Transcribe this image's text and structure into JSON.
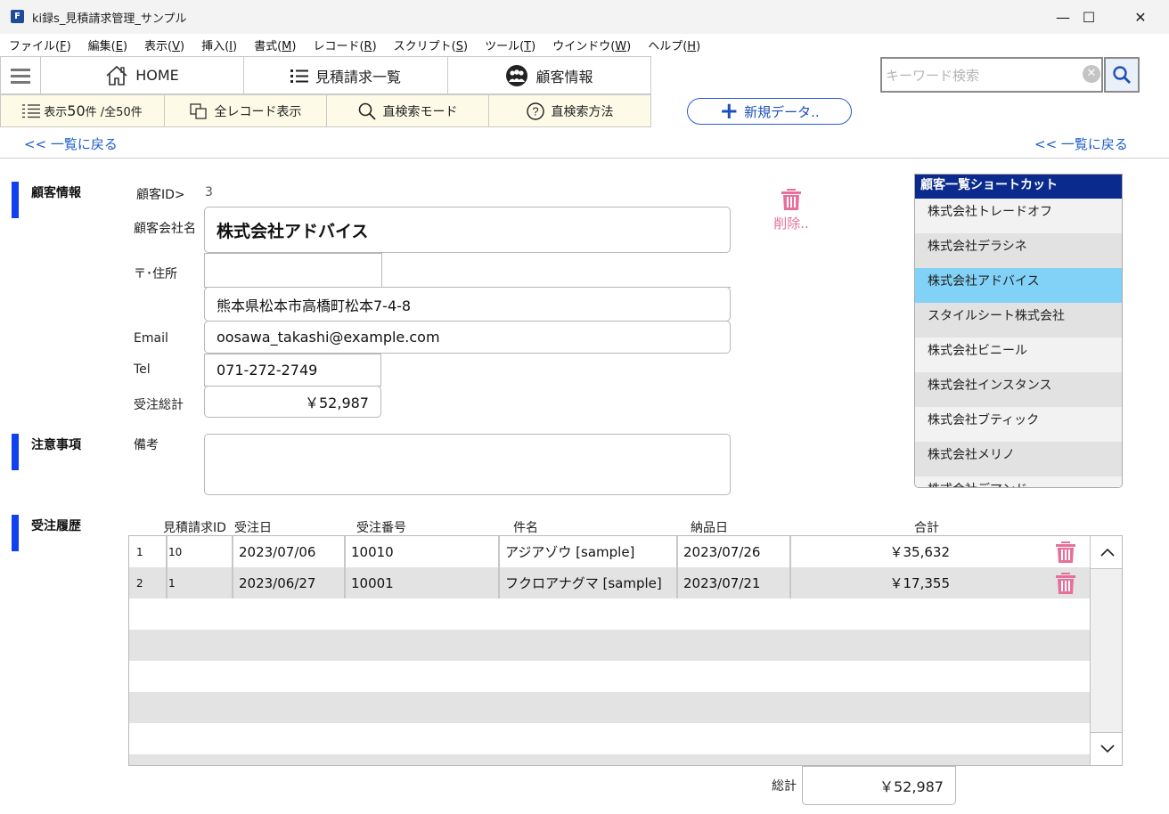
{
  "window": {
    "title": "ki録s_見積請求管理_サンプル",
    "app_icon": "F",
    "controls": {
      "minimize": "—",
      "maximize": "☐",
      "close": "✕"
    }
  },
  "menu": [
    {
      "label": "ファイル(",
      "key": "F",
      "tail": ")"
    },
    {
      "label": "編集(",
      "key": "E",
      "tail": ")"
    },
    {
      "label": "表示(",
      "key": "V",
      "tail": ")"
    },
    {
      "label": "挿入(",
      "key": "I",
      "tail": ")"
    },
    {
      "label": "書式(",
      "key": "M",
      "tail": ")"
    },
    {
      "label": "レコード(",
      "key": "R",
      "tail": ")"
    },
    {
      "label": "スクリプト(",
      "key": "S",
      "tail": ")"
    },
    {
      "label": "ツール(",
      "key": "T",
      "tail": ")"
    },
    {
      "label": "ウインドウ(",
      "key": "W",
      "tail": ")"
    },
    {
      "label": "ヘルプ(",
      "key": "H",
      "tail": ")"
    }
  ],
  "nav": {
    "home": "HOME",
    "estimates": "見積請求一覧",
    "customers": "顧客情報"
  },
  "toolbar": {
    "count_prefix": "表示",
    "count_num": "50",
    "count_suffix": "件 /全50件",
    "show_all": "全レコード表示",
    "find_mode": "直検索モード",
    "find_help": "直検索方法"
  },
  "search": {
    "placeholder": "キーワード検索",
    "value": ""
  },
  "new_button": "新規データ..",
  "back_link": "<< 一覧に戻る",
  "customer": {
    "section": "顧客情報",
    "id_label": "顧客ID>",
    "id": "3",
    "company_label": "顧客会社名",
    "company": "株式会社アドバイス",
    "address_label": "〒･住所",
    "zip": "",
    "zip2": "",
    "address": "熊本県松本市高橋町松本7-4-8",
    "email_label": "Email",
    "email": "oosawa_takashi@example.com",
    "tel_label": "Tel",
    "tel": "071-272-2749",
    "order_total_label": "受注総計",
    "order_total": "￥52,987"
  },
  "delete_label": "削除..",
  "notes": {
    "section": "注意事項",
    "label": "備考",
    "value": ""
  },
  "shortcut": {
    "title": "顧客一覧ショートカット",
    "items": [
      "株式会社トレードオフ",
      "株式会社デラシネ",
      "株式会社アドバイス",
      "スタイルシート株式会社",
      "株式会社ビニール",
      "株式会社インスタンス",
      "株式会社ブティック",
      "株式会社メリノ",
      "株式会社デマンド"
    ],
    "selected_index": 2
  },
  "orders": {
    "section": "受注履歴",
    "headers": {
      "estimate_id": "見積請求ID",
      "order_date": "受注日",
      "order_no": "受注番号",
      "subject": "件名",
      "delivery_date": "納品日",
      "total": "合計"
    },
    "rows": [
      {
        "no": "1",
        "estimate_id": "10",
        "order_date": "2023/07/06",
        "order_no": "10010",
        "subject": "アジアゾウ [sample]",
        "delivery_date": "2023/07/26",
        "total": "￥35,632"
      },
      {
        "no": "2",
        "estimate_id": "1",
        "order_date": "2023/06/27",
        "order_no": "10001",
        "subject": "フクロアナグマ [sample]",
        "delivery_date": "2023/07/21",
        "total": "￥17,355"
      }
    ],
    "grand_total_label": "総計",
    "grand_total": "￥52,987"
  }
}
